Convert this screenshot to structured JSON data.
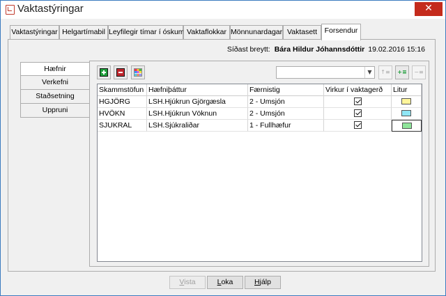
{
  "window": {
    "title": "Vaktastýringar",
    "close_glyph": "✕",
    "app_icon": "calendar-icon"
  },
  "tabs": [
    {
      "label": "Vaktastýringar",
      "active": false
    },
    {
      "label": "Helgartímabil",
      "active": false
    },
    {
      "label": "Leyfilegir tímar í óskum",
      "active": false
    },
    {
      "label": "Vaktaflokkar",
      "active": false
    },
    {
      "label": "Mönnunardagar",
      "active": false
    },
    {
      "label": "Vaktasett",
      "active": false
    },
    {
      "label": "Forsendur",
      "active": true
    }
  ],
  "last_changed": {
    "label": "Síðast breytt:",
    "user": "Bára Hildur Jóhannsdóttir",
    "timestamp": "19.02.2016 15:16"
  },
  "side_tabs": [
    {
      "label": "Hæfnir",
      "active": true
    },
    {
      "label": "Verkefni",
      "active": false
    },
    {
      "label": "Staðsetning",
      "active": false
    },
    {
      "label": "Uppruni",
      "active": false
    }
  ],
  "toolbar": {
    "add_icon": "add-icon",
    "remove_icon": "remove-icon",
    "color_icon": "color-grid-icon",
    "filter_value": "",
    "sort_icons": [
      "sort-asc-icon",
      "sort-add-icon",
      "sort-desc-icon"
    ]
  },
  "grid": {
    "columns": [
      "Skammstöfun",
      "Hæfniþáttur",
      "Færnistig",
      "Virkur í vaktagerð",
      "Litur"
    ],
    "rows": [
      {
        "abbr": "HGJÖRG",
        "skill": "LSH.Hjúkrun Gjörgæsla",
        "level": "2 - Umsjón",
        "active": true,
        "color": "#fff59a",
        "selected": false
      },
      {
        "abbr": "HVÖKN",
        "skill": "LSH.Hjúkrun Vöknun",
        "level": "2 - Umsjón",
        "active": true,
        "color": "#8fe6f5",
        "selected": false
      },
      {
        "abbr": "SJUKRAL",
        "skill": "LSH.Sjúkraliðar",
        "level": "1 - Fullhæfur",
        "active": true,
        "color": "#8fe59a",
        "selected": true
      }
    ]
  },
  "buttons": {
    "show": {
      "pre": "",
      "u": "V",
      "post": "ista"
    },
    "close": {
      "pre": "",
      "u": "L",
      "post": "oka"
    },
    "help": {
      "pre": "",
      "u": "H",
      "post": "jálp"
    }
  }
}
